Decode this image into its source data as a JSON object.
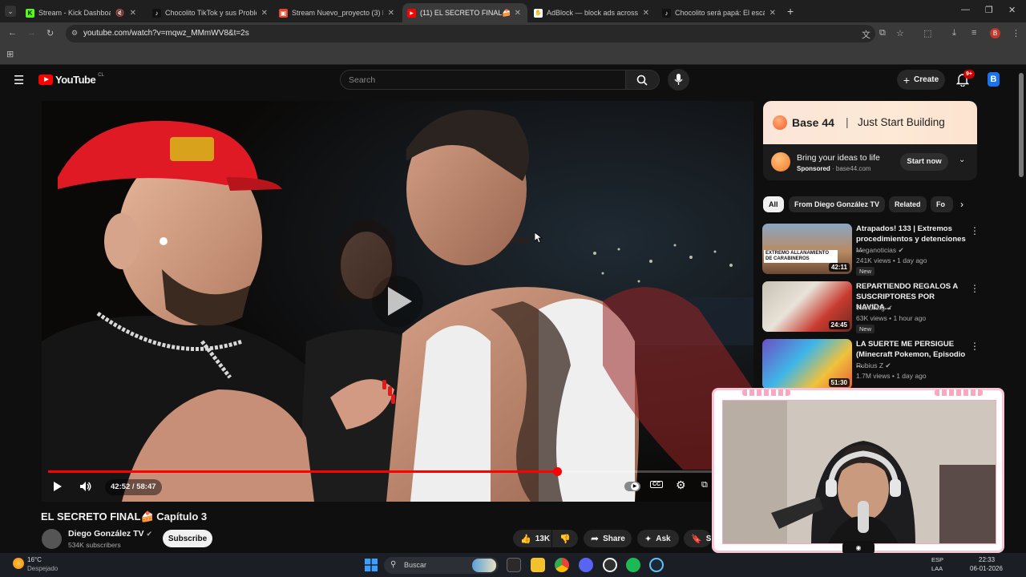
{
  "browser": {
    "tabs": [
      {
        "title": "Stream - Kick Dashboard",
        "favicon_color": "#53fc18",
        "favicon_glyph": "K"
      },
      {
        "title": "Chocolito TikTok y sus Problem",
        "favicon_color": "#111111",
        "favicon_glyph": "♪"
      },
      {
        "title": "Stream Nuevo_proyecto (3) by",
        "favicon_color": "#e8472b",
        "favicon_glyph": "▣"
      },
      {
        "title": "(11) EL SECRETO FINAL🍰 Cap",
        "favicon_color": "#ff0000",
        "favicon_glyph": "▶"
      },
      {
        "title": "AdBlock — block ads across th",
        "favicon_color": "#ffffff",
        "favicon_glyph": "✋"
      },
      {
        "title": "Chocolito será papá: El escánd",
        "favicon_color": "#111111",
        "favicon_glyph": "♪"
      }
    ],
    "new_tab": "+",
    "url": "youtube.com/watch?v=mqwz_MMmWV8&t=2s",
    "window_controls": [
      "—",
      "❐",
      "✕"
    ]
  },
  "youtube": {
    "logo_text": "YouTube",
    "country_code": "CL",
    "search_placeholder": "Search",
    "create_label": "Create",
    "notifications_badge": "9+",
    "video": {
      "title": "EL SECRETO FINAL🍰 Capítulo 3",
      "time_current": "42:52",
      "time_total": "58:47",
      "time_display": "42:52 / 58:47",
      "progress": 0.73,
      "channel": "Diego González TV",
      "subscribers": "534K subscribers",
      "subscribe_label": "Subscribe",
      "likes": "13K",
      "share_label": "Share",
      "ask_label": "Ask",
      "save_label": "Sa"
    },
    "ad": {
      "brand": "Base 44",
      "divider": "|",
      "tagline": "Just Start Building",
      "headline": "Bring your ideas to life",
      "sponsored": "Sponsored",
      "domain": "base44.com",
      "cta": "Start now"
    },
    "chips": [
      "All",
      "From Diego González TV",
      "Related",
      "Fo"
    ],
    "recommendations": [
      {
        "title": "Atrapados! 133 | Extremos procedimientos y detenciones ...",
        "channel": "Meganoticias",
        "meta": "241K views • 1 day ago",
        "badge": "New",
        "duration": "42:11",
        "thumb_caption": "EXTREMO ALLANAMIENTO DE CARABINEROS"
      },
      {
        "title": "REPARTIENDO REGALOS A SUSCRIPTORES POR NAVIDA...",
        "channel": "TheGrefg",
        "meta": "63K views • 1 hour ago",
        "badge": "New",
        "duration": "24:45"
      },
      {
        "title": "LA SUERTE ME PERSIGUE (Minecraft Pokemon, Episodio ...",
        "channel": "Rubius Z",
        "meta": "1.7M views • 1 day ago",
        "duration": "51:30"
      }
    ]
  },
  "taskbar": {
    "weather_temp": "16°C",
    "weather_desc": "Despejado",
    "search_label": "Buscar",
    "lang": "ESP",
    "lang2": "LAA",
    "time": "22:33",
    "date": "06-01-2026"
  },
  "colors": {
    "youtube_red": "#ff0000",
    "background": "#0f0f0f",
    "webcam_border": "#f8c6d4"
  }
}
